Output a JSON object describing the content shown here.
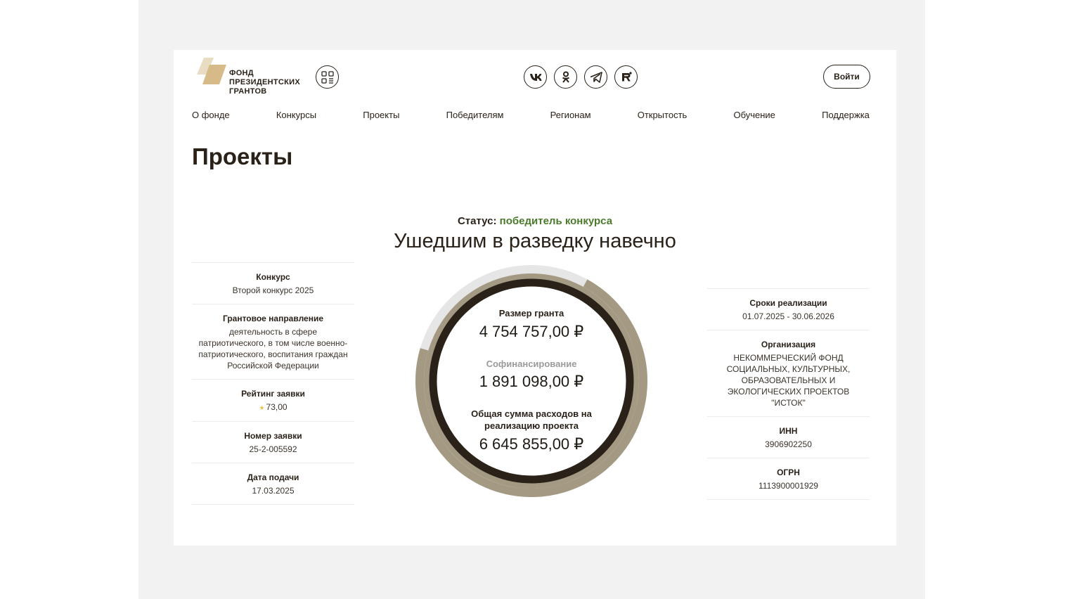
{
  "header": {
    "logo_lines": [
      "ФОНД",
      "ПРЕЗИДЕНТСКИХ",
      "ГРАНТОВ"
    ],
    "qr_icon": "qr-code-icon",
    "socials": [
      {
        "name": "vk-icon",
        "label": "VK"
      },
      {
        "name": "odnoklassniki-icon",
        "label": "OK"
      },
      {
        "name": "telegram-icon",
        "label": "Telegram"
      },
      {
        "name": "rutube-icon",
        "label": "R"
      }
    ],
    "login_label": "Войти"
  },
  "nav": [
    "О фонде",
    "Конкурсы",
    "Проекты",
    "Победителям",
    "Регионам",
    "Открытость",
    "Обучение",
    "Поддержка"
  ],
  "page_title": "Проекты",
  "status": {
    "label": "Статус:",
    "value": "победитель конкурса"
  },
  "project_title": "Ушедшим в разведку навечно",
  "left_info": [
    {
      "label": "Конкурс",
      "value": "Второй конкурс 2025"
    },
    {
      "label": "Грантовое направление",
      "value": "деятельность в сфере патриотического, в том числе военно-патриотического, воспитания граждан Российской Федерации"
    },
    {
      "label": "Рейтинг заявки",
      "value": "73,00"
    },
    {
      "label": "Номер заявки",
      "value": "25-2-005592"
    },
    {
      "label": "Дата подачи",
      "value": "17.03.2025"
    }
  ],
  "right_info": [
    {
      "label": "Сроки реализации",
      "value": "01.07.2025 - 30.06.2026"
    },
    {
      "label": "Организация",
      "value": "НЕКОММЕРЧЕСКИЙ ФОНД СОЦИАЛЬНЫХ, КУЛЬТУРНЫХ, ОБРАЗОВАТЕЛЬНЫХ И ЭКОЛОГИЧЕСКИХ ПРОЕКТОВ \"ИСТОК\""
    },
    {
      "label": "ИНН",
      "value": "3906902250"
    },
    {
      "label": "ОГРН",
      "value": "1113900001929"
    }
  ],
  "finance": {
    "grant_label": "Размер гранта",
    "grant_value": "4 754 757,00 ₽",
    "cofinancing_label": "Софинансирование",
    "cofinancing_value": "1 891 098,00 ₽",
    "total_label": "Общая сумма расходов на реализацию проекта",
    "total_value": "6 645 855,00 ₽",
    "grant_share": 0.7155
  },
  "colors": {
    "accent_dark": "#2a2219",
    "ring_outer": "#a49a84",
    "ring_track": "#e6e6e6",
    "status_green": "#4a7a2a",
    "logo_gold": "#d6bb88"
  }
}
